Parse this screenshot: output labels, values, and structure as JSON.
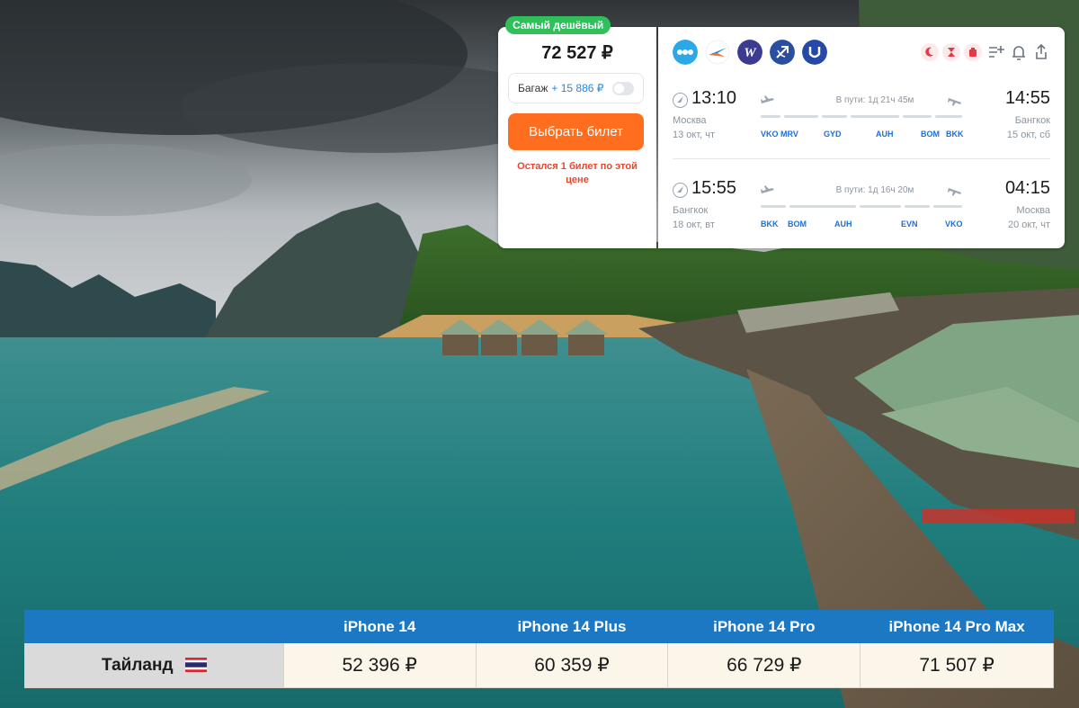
{
  "ticket": {
    "badge": "Самый дешёвый",
    "price": "72 527 ₽",
    "baggage_label": "Багаж",
    "baggage_price": "+ 15 886 ₽",
    "buy_label": "Выбрать билет",
    "warning": "Остался 1 билет по этой цене",
    "airline_icons": [
      "dots-logo",
      "swallow-logo",
      "w-logo",
      "archer-logo",
      "u-logo"
    ],
    "tool_icons": [
      "add-list-icon",
      "bell-icon",
      "share-icon"
    ],
    "legs": [
      {
        "dep_time": "13:10",
        "arr_time": "14:55",
        "dep_city": "Москва",
        "arr_city": "Бангкок",
        "dep_date": "13 окт, чт",
        "arr_date": "15 окт, сб",
        "duration": "В пути: 1д 21ч 45м",
        "codes": [
          "VKO",
          "MRV",
          "GYD",
          "AUH",
          "BOM",
          "BKK"
        ]
      },
      {
        "dep_time": "15:55",
        "arr_time": "04:15",
        "dep_city": "Бангкок",
        "arr_city": "Москва",
        "dep_date": "18 окт, вт",
        "arr_date": "20 окт, чт",
        "duration": "В пути: 1д 16ч 20м",
        "codes": [
          "BKK",
          "BOM",
          "AUH",
          "EVN",
          "VKO"
        ]
      }
    ]
  },
  "price_table": {
    "headers": [
      "",
      "iPhone 14",
      "iPhone 14 Plus",
      "iPhone 14 Pro",
      "iPhone 14 Pro Max"
    ],
    "row": {
      "country": "Тайланд",
      "values": [
        "52 396 ₽",
        "60 359 ₽",
        "66 729 ₽",
        "71 507 ₽"
      ]
    }
  },
  "colors": {
    "accent_orange": "#ff6d1f",
    "badge_green": "#2fc05b",
    "table_header": "#1d78c4",
    "link_blue": "#1e6fd9",
    "warning_red": "#e8462e"
  }
}
